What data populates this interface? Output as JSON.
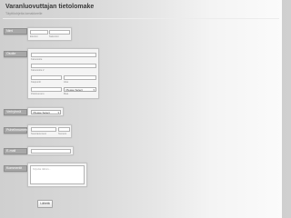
{
  "form": {
    "title": "Varanluovuttajan tietolomake",
    "subtitle": "Täyttöohjeita lomakkeelle"
  },
  "name": {
    "label": "Nimi",
    "first_sub": "Etunimi",
    "last_sub": "Sukunimi",
    "first_value": "",
    "last_value": ""
  },
  "address": {
    "label": "Osoite",
    "line1_sub": "Katuosoite",
    "line2_sub": "Katuosoite 2",
    "city_sub": "Kaupunki",
    "region_sub": "Alue",
    "postal_sub": "Postinumero",
    "country_sub": "Maa",
    "country_selected": "Please Select"
  },
  "bloodtype": {
    "label": "Veriryhmä",
    "selected": "Please Select"
  },
  "phone": {
    "label": "Puhelinnumero",
    "area_sub": "Suuntanumero",
    "number_sub": "Numero"
  },
  "email": {
    "label": "E-mail"
  },
  "comments": {
    "label": "Kommentit",
    "placeholder": "Kirjoita tähän..."
  },
  "submit": {
    "label": "Lähetä"
  }
}
